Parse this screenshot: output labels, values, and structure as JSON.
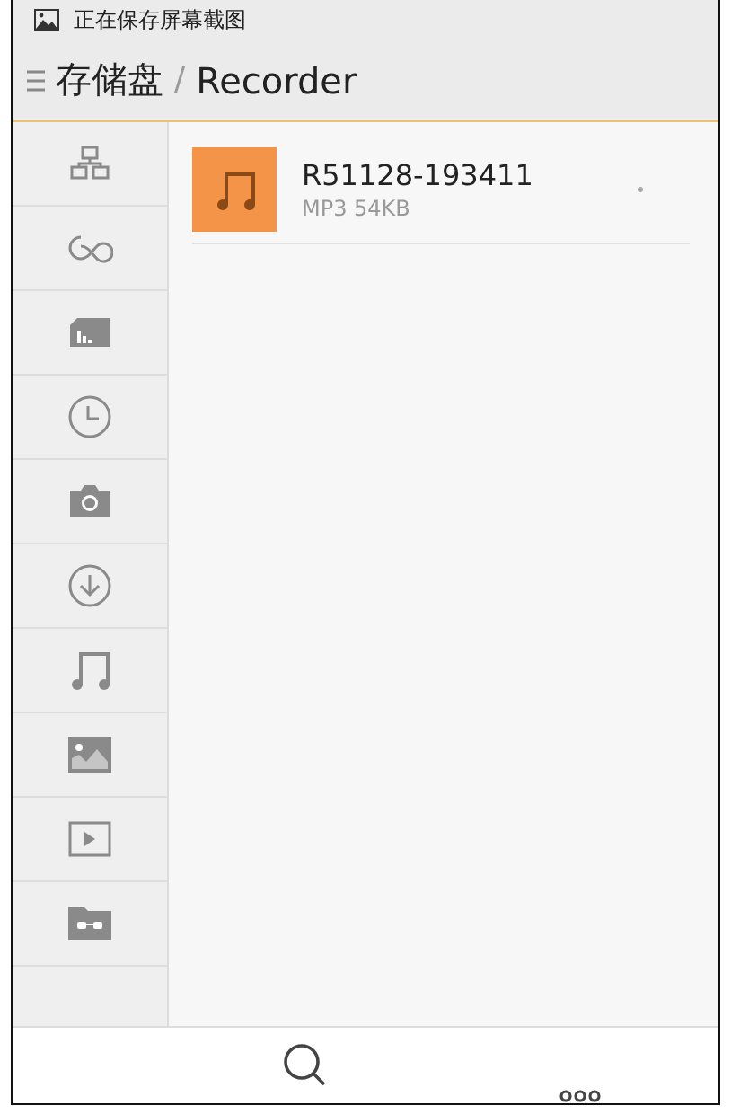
{
  "status_bar": {
    "text": "正在保存屏幕截图"
  },
  "title_bar": {
    "path": [
      "存储盘",
      "Recorder"
    ],
    "separator": "/"
  },
  "sidebar": {
    "items": [
      {
        "kind": "network"
      },
      {
        "kind": "cloud"
      },
      {
        "kind": "storage"
      },
      {
        "kind": "recent"
      },
      {
        "kind": "camera"
      },
      {
        "kind": "download"
      },
      {
        "kind": "music"
      },
      {
        "kind": "image"
      },
      {
        "kind": "video"
      },
      {
        "kind": "folder"
      }
    ]
  },
  "files": [
    {
      "kind": "audio",
      "name": "R51128-193411",
      "meta": "MP3 54KB"
    }
  ],
  "bottom_bar": {
    "items": [
      {
        "kind": "search"
      },
      {
        "kind": "more"
      }
    ]
  }
}
